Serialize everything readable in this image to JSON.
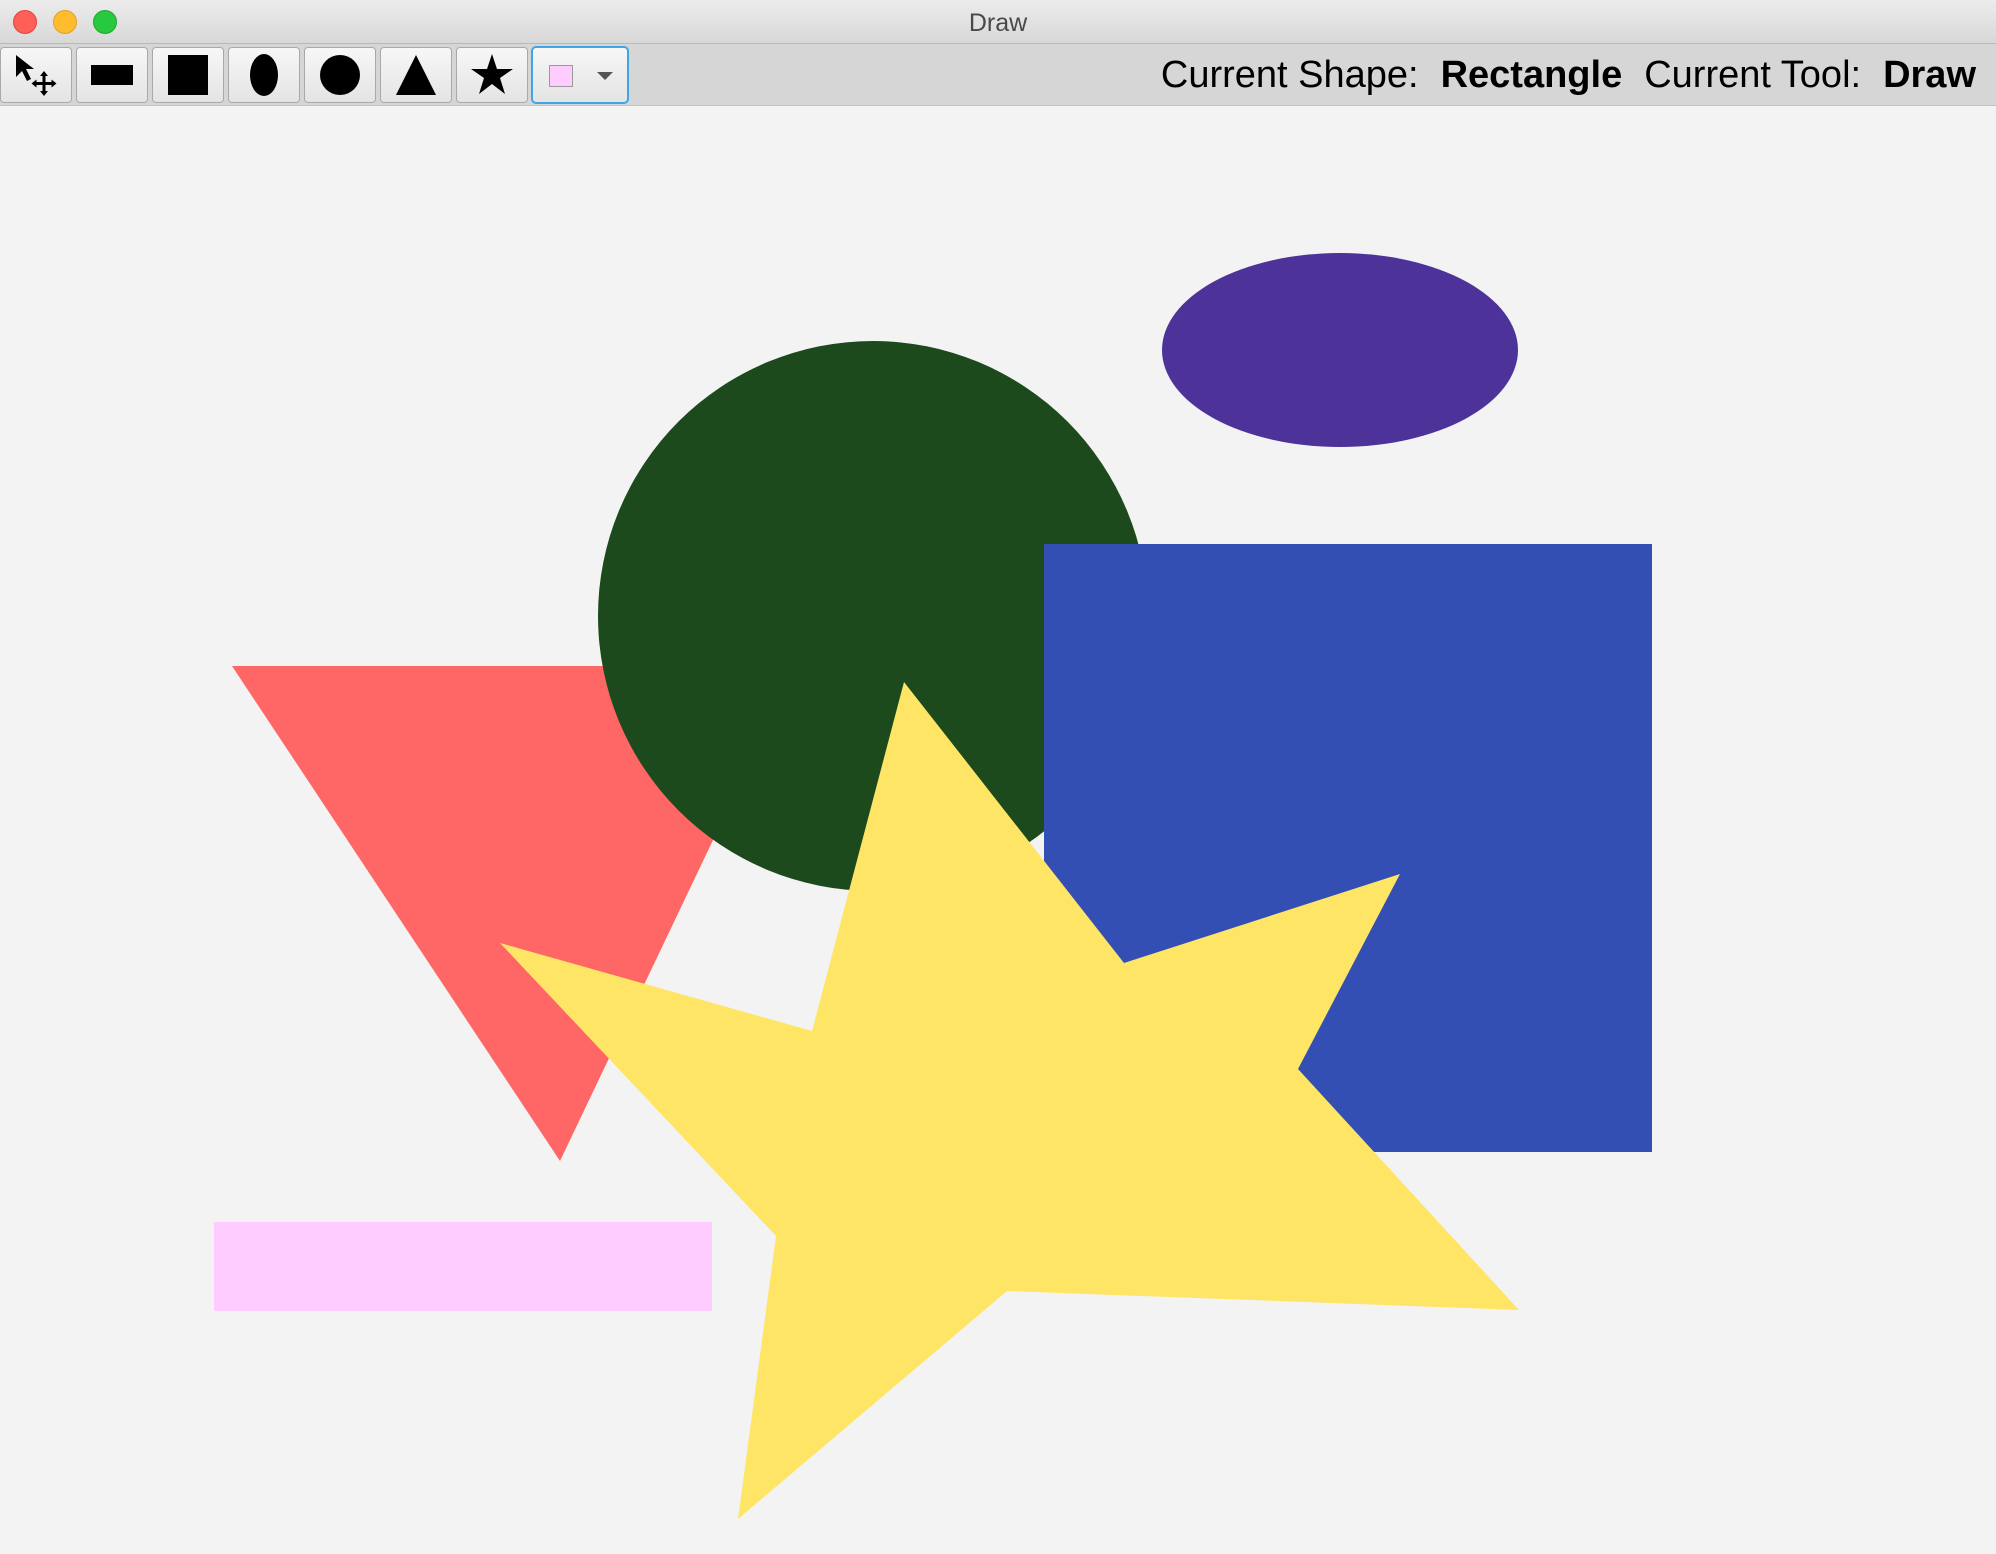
{
  "window": {
    "title": "Draw"
  },
  "toolbar": {
    "tools": [
      {
        "name": "select-move",
        "icon": "select-move-icon"
      },
      {
        "name": "rectangle",
        "icon": "rectangle-icon"
      },
      {
        "name": "square",
        "icon": "square-icon"
      },
      {
        "name": "ellipse",
        "icon": "ellipse-icon"
      },
      {
        "name": "circle",
        "icon": "circle-icon"
      },
      {
        "name": "triangle",
        "icon": "triangle-icon"
      },
      {
        "name": "star",
        "icon": "star-icon"
      }
    ],
    "selected_color": "#ffccff"
  },
  "status": {
    "shape_label": "Current Shape:",
    "shape_value": "Rectangle",
    "tool_label": "Current Tool:",
    "tool_value": "Draw"
  },
  "canvas": {
    "background": "#f3f3f3",
    "shapes": [
      {
        "type": "triangle",
        "fill": "#ff6666"
      },
      {
        "type": "circle",
        "fill": "#1c4a1c"
      },
      {
        "type": "ellipse",
        "fill": "#4d3399"
      },
      {
        "type": "square",
        "fill": "#334fb3"
      },
      {
        "type": "star",
        "fill": "#ffe566"
      },
      {
        "type": "rectangle",
        "fill": "#ffccff"
      }
    ]
  }
}
